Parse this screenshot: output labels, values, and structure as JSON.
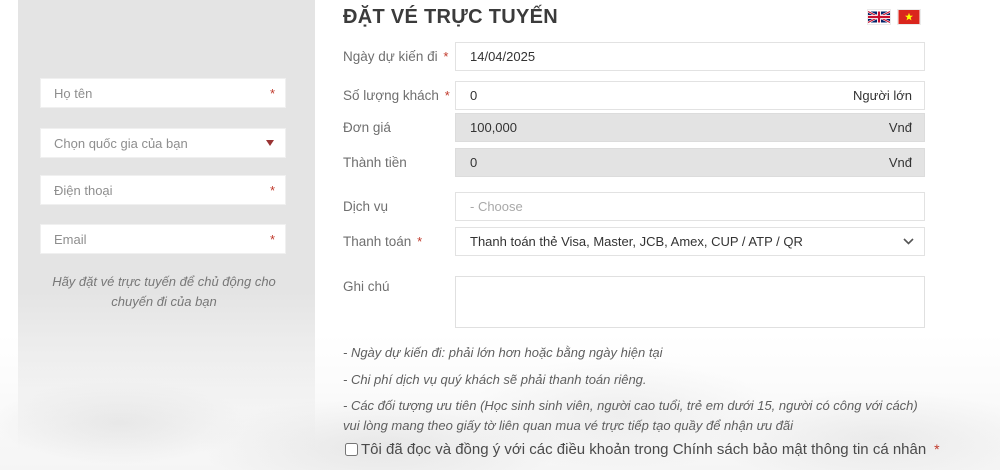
{
  "header": {
    "title": "ĐẶT VÉ TRỰC TUYẾN",
    "language_switcher": {
      "flags": [
        "uk-flag",
        "vietnam-flag"
      ]
    }
  },
  "required_mark": "*",
  "sidebar": {
    "name_placeholder": "Họ tên",
    "country_placeholder": "Chọn quốc gia của bạn",
    "phone_placeholder": "Điện thoại",
    "email_placeholder": "Email",
    "caption": "Hãy đặt vé trực tuyến để chủ động cho chuyến đi của bạn"
  },
  "form": {
    "date": {
      "label": "Ngày dự kiến đi",
      "value": "14/04/2025"
    },
    "quantity": {
      "label": "Số lượng khách",
      "value": "0",
      "unit": "Người lớn"
    },
    "unit_price": {
      "label": "Đơn giá",
      "value": "100,000",
      "unit": "Vnđ"
    },
    "total": {
      "label": "Thành tiền",
      "value": "0",
      "unit": "Vnđ"
    },
    "service": {
      "label": "Dịch vụ",
      "placeholder": "- Choose"
    },
    "payment": {
      "label": "Thanh toán",
      "value": "Thanh toán thẻ Visa, Master, JCB, Amex, CUP / ATP / QR"
    },
    "note": {
      "label": "Ghi chú",
      "value": ""
    }
  },
  "notes": {
    "n1": "- Ngày dự kiến đi: phải lớn hơn hoặc bằng ngày hiện tại",
    "n2": "- Chi phí dịch vụ quý khách sẽ phải thanh toán riêng.",
    "n3": "- Các đối tượng ưu tiên (Học sinh sinh viên, người cao tuổi, trẻ em dưới 15, người có công với cách) vui lòng mang theo giấy tờ liên quan mua vé trực tiếp tạo quầy để nhận ưu đãi"
  },
  "consent": {
    "label": "Tôi đã đọc và đồng ý với các điều khoản trong Chính sách bảo mật thông tin cá nhân",
    "checked": false
  },
  "colors": {
    "accent_red": "#c0392b",
    "panel_grey": "#e4e4e4",
    "disabled_grey": "#e3e3e3",
    "label_grey": "#6f6f6f"
  }
}
